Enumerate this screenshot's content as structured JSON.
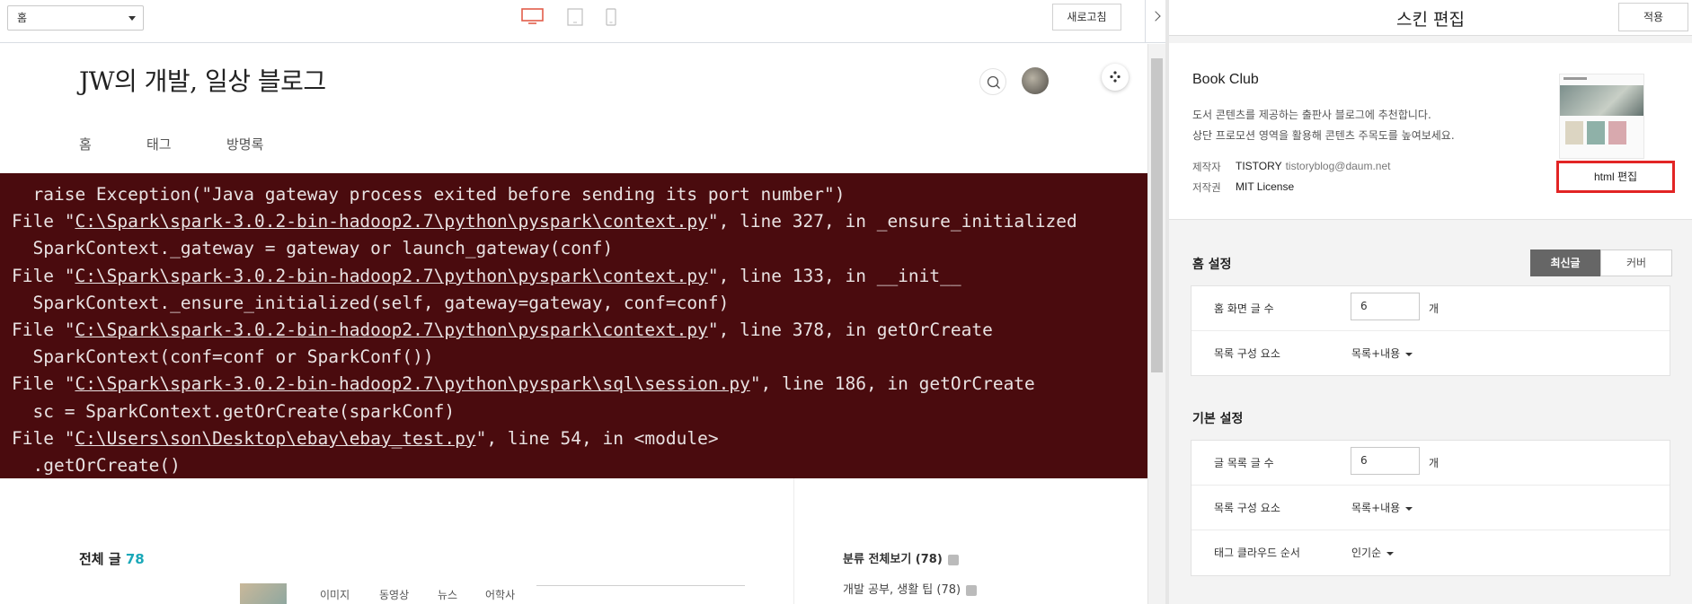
{
  "topbar": {
    "page_select": "홈",
    "refresh_label": "새로고침"
  },
  "colors": {
    "accent": "#e35d4a",
    "code_bg": "#4a0b0e",
    "highlight_border": "#e22424",
    "count_color": "#1aa8b8"
  },
  "preview": {
    "blog_title": "JW의 개발, 일상 블로그",
    "nav": [
      "홈",
      "태그",
      "방명록"
    ],
    "code_lines": [
      {
        "pre": "  raise Exception(\"Java gateway process exited before sending its port number\")",
        "link": "",
        "post": ""
      },
      {
        "pre": "File \"",
        "link": "C:\\Spark\\spark-3.0.2-bin-hadoop2.7\\python\\pyspark\\context.py",
        "post": "\", line 327, in _ensure_initialized"
      },
      {
        "pre": "  SparkContext._gateway = gateway or launch_gateway(conf)",
        "link": "",
        "post": ""
      },
      {
        "pre": "File \"",
        "link": "C:\\Spark\\spark-3.0.2-bin-hadoop2.7\\python\\pyspark\\context.py",
        "post": "\", line 133, in __init__"
      },
      {
        "pre": "  SparkContext._ensure_initialized(self, gateway=gateway, conf=conf)",
        "link": "",
        "post": ""
      },
      {
        "pre": "File \"",
        "link": "C:\\Spark\\spark-3.0.2-bin-hadoop2.7\\python\\pyspark\\context.py",
        "post": "\", line 378, in getOrCreate"
      },
      {
        "pre": "  SparkContext(conf=conf or SparkConf())",
        "link": "",
        "post": ""
      },
      {
        "pre": "File \"",
        "link": "C:\\Spark\\spark-3.0.2-bin-hadoop2.7\\python\\pyspark\\sql\\session.py",
        "post": "\", line 186, in getOrCreate"
      },
      {
        "pre": "  sc = SparkContext.getOrCreate(sparkConf)",
        "link": "",
        "post": ""
      },
      {
        "pre": "File \"",
        "link": "C:\\Users\\son\\Desktop\\ebay\\ebay_test.py",
        "post": "\", line 54, in <module>"
      },
      {
        "pre": "  .getOrCreate()",
        "link": "",
        "post": ""
      }
    ],
    "all_posts_label": "전체 글",
    "all_posts_count": "78",
    "tabs": [
      "이미지",
      "동영상",
      "뉴스",
      "어학사"
    ],
    "category_all": "분류 전체보기 (78)",
    "category_1": "개발 공부, 생활 팁 (78)"
  },
  "panel": {
    "title": "스킨 편집",
    "apply_label": "적용",
    "skin": {
      "name": "Book Club",
      "desc1": "도서 콘텐츠를 제공하는 출판사 블로그에 추천합니다.",
      "desc2": "상단 프로모션 영역을 활용해 콘텐츠 주목도를 높여보세요.",
      "maker_label": "제작자",
      "maker": "TISTORY",
      "maker_email": "tistoryblog@daum.net",
      "license_label": "저작권",
      "license": "MIT License",
      "html_edit_label": "html 편집"
    },
    "home_settings": {
      "title": "홈 설정",
      "seg_on": "최신글",
      "seg_off": "커버",
      "rows": [
        {
          "label": "홈 화면 글 수",
          "value": "6",
          "unit": "개"
        },
        {
          "label": "목록 구성 요소",
          "value": "목록+내용"
        }
      ]
    },
    "basic_settings": {
      "title": "기본 설정",
      "rows": [
        {
          "label": "글 목록 글 수",
          "value": "6",
          "unit": "개"
        },
        {
          "label": "목록 구성 요소",
          "value": "목록+내용"
        },
        {
          "label": "태그 클라우드 순서",
          "value": "인기순"
        }
      ]
    }
  }
}
